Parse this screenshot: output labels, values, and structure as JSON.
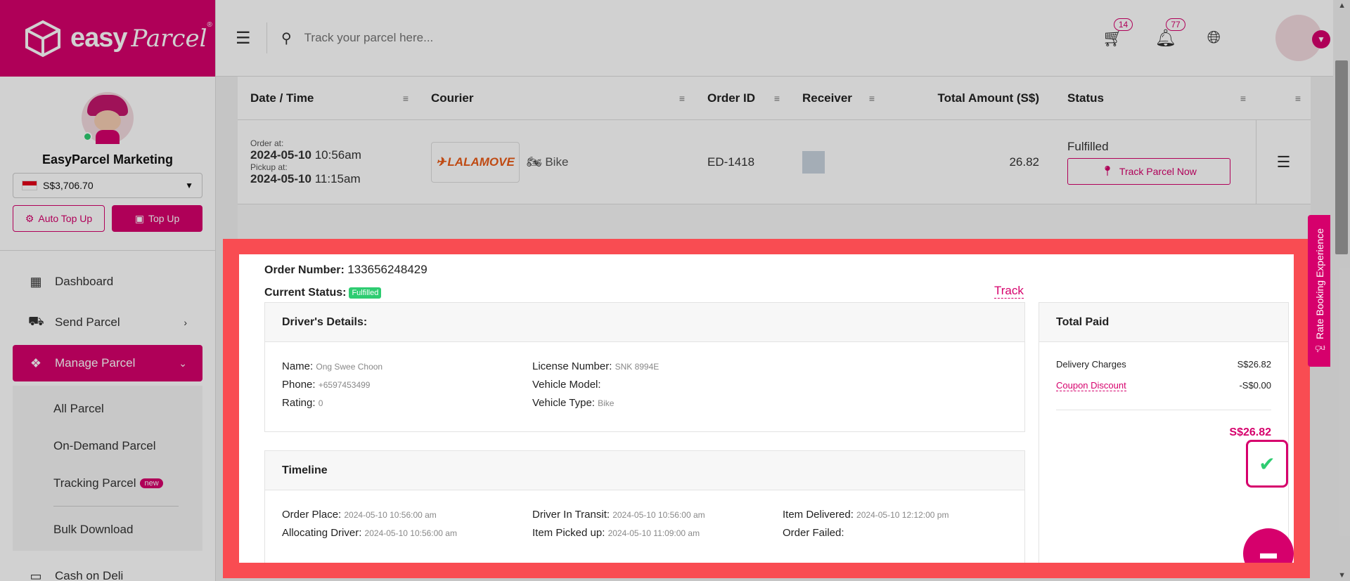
{
  "brand": {
    "name": "easy",
    "script": "Parcel",
    "mark": "®"
  },
  "sidebar": {
    "profile_name": "EasyParcel Marketing",
    "balance": "S$3,706.70",
    "auto_topup": "Auto Top Up",
    "topup": "Top Up",
    "nav": [
      {
        "label": "Dashboard",
        "icon": "dashboard-icon"
      },
      {
        "label": "Send Parcel",
        "icon": "truck-icon"
      },
      {
        "label": "Manage Parcel",
        "icon": "parcels-icon"
      }
    ],
    "sub": [
      {
        "label": "All Parcel"
      },
      {
        "label": "On-Demand Parcel"
      },
      {
        "label": "Tracking Parcel",
        "badge": "new"
      },
      {
        "label": "Bulk Download"
      }
    ],
    "next_partial": "Cash on Deli"
  },
  "header": {
    "search_placeholder": "Track your parcel here...",
    "cart_count": "14",
    "notif_count": "77"
  },
  "table": {
    "columns": [
      "Date / Time",
      "Courier",
      "Order ID",
      "Receiver",
      "Total Amount (S$)",
      "Status"
    ],
    "row": {
      "order_at_label": "Order at:",
      "order_date": "2024-05-10",
      "order_time": "10:56am",
      "pickup_at_label": "Pickup at:",
      "pickup_date": "2024-05-10",
      "pickup_time": "11:15am",
      "courier": "LALAMOVE",
      "vehicle": "Bike",
      "order_id": "ED-1418",
      "amount": "26.82",
      "status": "Fulfilled",
      "track_button": "Track Parcel Now"
    }
  },
  "detail": {
    "order_number_label": "Order Number:",
    "order_number": "133656248429",
    "current_status_label": "Current Status:",
    "current_status": "Fulfilled",
    "track_link": "Track",
    "driver": {
      "title": "Driver's Details:",
      "name_label": "Name:",
      "name": "Ong Swee Choon",
      "phone_label": "Phone:",
      "phone": "+6597453499",
      "rating_label": "Rating:",
      "rating": "0",
      "license_label": "License Number:",
      "license": "SNK 8994E",
      "model_label": "Vehicle Model:",
      "model": "",
      "type_label": "Vehicle Type:",
      "type": "Bike"
    },
    "timeline": {
      "title": "Timeline",
      "order_place_label": "Order Place:",
      "order_place": "2024-05-10 10:56:00 am",
      "allocating_label": "Allocating Driver:",
      "allocating": "2024-05-10 10:56:00 am",
      "in_transit_label": "Driver In Transit:",
      "in_transit": "2024-05-10 10:56:00 am",
      "picked_label": "Item Picked up:",
      "picked": "2024-05-10 11:09:00 am",
      "delivered_label": "Item Delivered:",
      "delivered": "2024-05-10 12:12:00 pm",
      "failed_label": "Order Failed:",
      "failed": ""
    },
    "payment": {
      "title": "Total Paid",
      "delivery_label": "Delivery Charges",
      "delivery": "S$26.82",
      "coupon_label": "Coupon Discount",
      "coupon": "-S$0.00",
      "total": "S$26.82"
    }
  },
  "rate_tab": "Rate Booking Experience",
  "colors": {
    "brand": "#d6006c",
    "highlight": "#f94c52",
    "success": "#2ecc71"
  }
}
